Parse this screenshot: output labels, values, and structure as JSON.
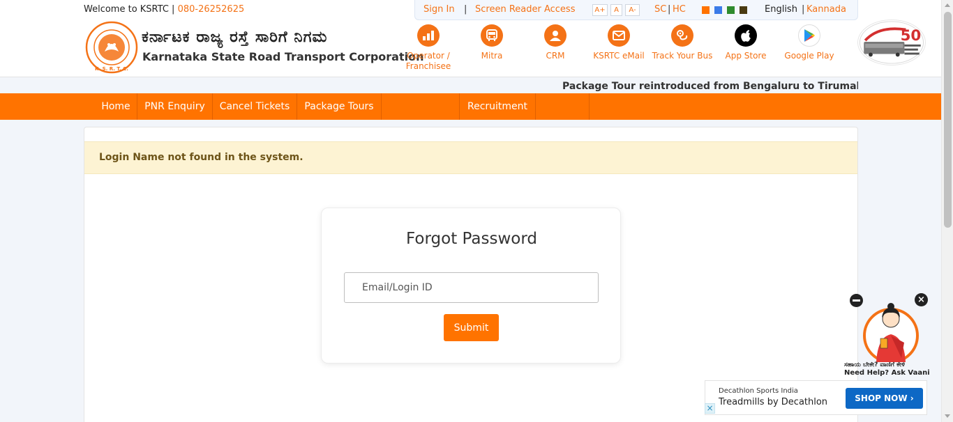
{
  "header": {
    "welcome_text": "Welcome to KSRTC |",
    "phone": "080-26252625",
    "brand_kannada": "ಕರ್ನಾಟಕ ರಾಜ್ಯ ರಸ್ತೆ ಸಾರಿಗೆ ನಿಗಮ",
    "brand_english": "Karnataka State Road Transport Corporation",
    "logo_letters": "K. S. R. T. C."
  },
  "topbar": {
    "sign_in": "Sign In",
    "separator": "|",
    "screen_reader": "Screen Reader Access",
    "font_increase": "A+",
    "font_normal": "A",
    "font_decrease": "A-",
    "sc": "SC",
    "hc": "HC",
    "pipe": "|",
    "theme_colors": [
      "#ff7300",
      "#3b7be8",
      "#2e8b2e",
      "#4a3b12"
    ],
    "lang_english": "English",
    "lang_pipe": "|",
    "lang_kannada": "Kannada"
  },
  "services": [
    {
      "label": "Operator / Franchisee",
      "icon": "operator-chart-icon"
    },
    {
      "label": "Mitra",
      "icon": "bus-icon"
    },
    {
      "label": "CRM",
      "icon": "user-icon"
    },
    {
      "label": "KSRTC eMail",
      "icon": "mail-icon"
    },
    {
      "label": "Track Your Bus",
      "icon": "location-route-icon"
    },
    {
      "label": "App Store",
      "icon": "apple-icon"
    },
    {
      "label": "Google Play",
      "icon": "google-play-icon"
    }
  ],
  "ticker": "Package Tour reintroduced from Bengaluru to Tirumala w.e.",
  "nav": {
    "items": [
      "Home",
      "PNR Enquiry",
      "Cancel Tickets",
      "Package Tours",
      "",
      "Recruitment",
      ""
    ]
  },
  "alert": {
    "message": "Login Name not found in the system."
  },
  "forgot": {
    "title": "Forgot Password",
    "placeholder": "Email/Login ID",
    "submit": "Submit"
  },
  "vaani": {
    "kannada": "ಸಹಾಯ ಬೇಕೇ? ವಾಣಿಗೆ ಕೇಳಿ",
    "english": "Need Help? Ask Vaani"
  },
  "ad": {
    "advertiser": "Decathlon Sports India",
    "headline": "Treadmills by Decathlon",
    "cta": "SHOP NOW ›"
  }
}
